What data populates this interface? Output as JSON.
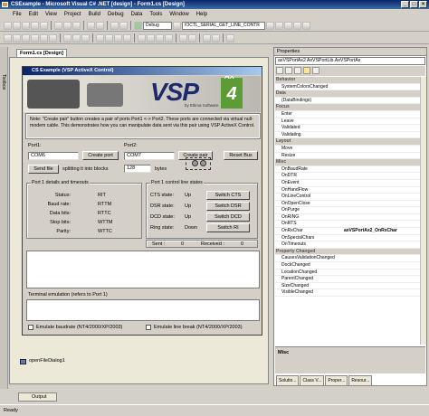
{
  "window": {
    "title": "CSExample - Microsoft Visual C# .NET [design] - Form1.cs [Design]"
  },
  "menu": [
    "File",
    "Edit",
    "View",
    "Project",
    "Build",
    "Debug",
    "Data",
    "Tools",
    "Window",
    "Help"
  ],
  "toolbar": {
    "config_combo": "Debug",
    "find_combo": "IOCTL_SERIAL_GET_LINE_CONTR"
  },
  "left_strip": {
    "label": "Toolbox"
  },
  "doc_tab": {
    "label": "Form1.cs [Design]"
  },
  "form": {
    "title": "CS Example (VSP ActiveX Control)",
    "banner": {
      "logo": "VSP",
      "badge_sup": "AX",
      "badge_num": "4",
      "byline": "by Eltima Software"
    },
    "note": "Note: \"Create pair\" button creates a pair of ports Port1 <-> Port2. These ports are connected via virtual null-modem cable. This demonstrates how you can manipulate data sent via this pair using VSP ActiveX Control.",
    "port1_label": "Port1:",
    "port2_label": "Port2:",
    "port1_value": "COM6",
    "port2_value": "COM7",
    "create_port": "Create port",
    "create_pair": "Create pair",
    "reset_bus": "Reset Bus",
    "send_file": "Send file",
    "splitting_label": "splitting it into blocks",
    "block_value": "128",
    "bytes_label": "bytes",
    "details_group": "Port 1 details and timeouts",
    "details": [
      {
        "k": "Status:",
        "v": "RIT"
      },
      {
        "k": "Baud rate:",
        "v": "RTTM"
      },
      {
        "k": "Data bits:",
        "v": "RTTC"
      },
      {
        "k": "Stop bits:",
        "v": "WTTM"
      },
      {
        "k": "Parity:",
        "v": "WTTC"
      }
    ],
    "control_group": "Port 1 control line states",
    "states": [
      {
        "k": "CTS state:",
        "v": "Up",
        "btn": "Switch CTS"
      },
      {
        "k": "DSR state:",
        "v": "Up",
        "btn": "Switch DSR"
      },
      {
        "k": "DCD state:",
        "v": "Up",
        "btn": "Switch DCD"
      },
      {
        "k": "Ring state:",
        "v": "Down",
        "btn": "Switch RI"
      }
    ],
    "sent": "Sent :",
    "sent_value": "0",
    "received": "Received :",
    "received_value": "0",
    "terminal_label": "Terminal emulation (refers to Port 1)",
    "emulate_baud": "Emulate baudrate (NT4/2000/XP/2003)",
    "emulate_break": "Emulate line break (NT4/2000/XP/2003)"
  },
  "tray": {
    "component": "openFileDialog1"
  },
  "properties": {
    "header": "Properties",
    "object": "axVSPortAx2 AxVSPortLib.AxVSPortAx",
    "rows": [
      {
        "k": "Behavior",
        "v": "",
        "cat": true
      },
      {
        "k": "SystemColorsChanged",
        "v": ""
      },
      {
        "k": "Data",
        "v": "",
        "cat": true
      },
      {
        "k": "(DataBindings)",
        "v": ""
      },
      {
        "k": "Focus",
        "v": "",
        "cat": true
      },
      {
        "k": "Enter",
        "v": ""
      },
      {
        "k": "Leave",
        "v": ""
      },
      {
        "k": "Validated",
        "v": ""
      },
      {
        "k": "Validating",
        "v": ""
      },
      {
        "k": "Layout",
        "v": "",
        "cat": true
      },
      {
        "k": "Move",
        "v": ""
      },
      {
        "k": "Resize",
        "v": ""
      },
      {
        "k": "Misc",
        "v": "",
        "cat": true
      },
      {
        "k": "OnBaudRate",
        "v": ""
      },
      {
        "k": "OnDTR",
        "v": ""
      },
      {
        "k": "OnEvent",
        "v": ""
      },
      {
        "k": "OnHandFlow",
        "v": ""
      },
      {
        "k": "OnLineControl",
        "v": ""
      },
      {
        "k": "OnOpenClose",
        "v": ""
      },
      {
        "k": "OnPurge",
        "v": ""
      },
      {
        "k": "OnRING",
        "v": ""
      },
      {
        "k": "OnRTS",
        "v": ""
      },
      {
        "k": "OnRxChar",
        "v": "axVSPortAx2_OnRxChar"
      },
      {
        "k": "OnSpecialChars",
        "v": ""
      },
      {
        "k": "OnTimeouts",
        "v": ""
      },
      {
        "k": "Property Changed",
        "v": "",
        "cat": true
      },
      {
        "k": "CausesValidationChanged",
        "v": ""
      },
      {
        "k": "DockChanged",
        "v": ""
      },
      {
        "k": "LocationChanged",
        "v": ""
      },
      {
        "k": "ParentChanged",
        "v": ""
      },
      {
        "k": "SizeChanged",
        "v": ""
      },
      {
        "k": "VisibleChanged",
        "v": ""
      }
    ],
    "desc": "Misc",
    "tabs": [
      "Solutio...",
      "Class V...",
      "Proper...",
      "Resour..."
    ]
  },
  "output_tab": "Output",
  "status": "Ready"
}
